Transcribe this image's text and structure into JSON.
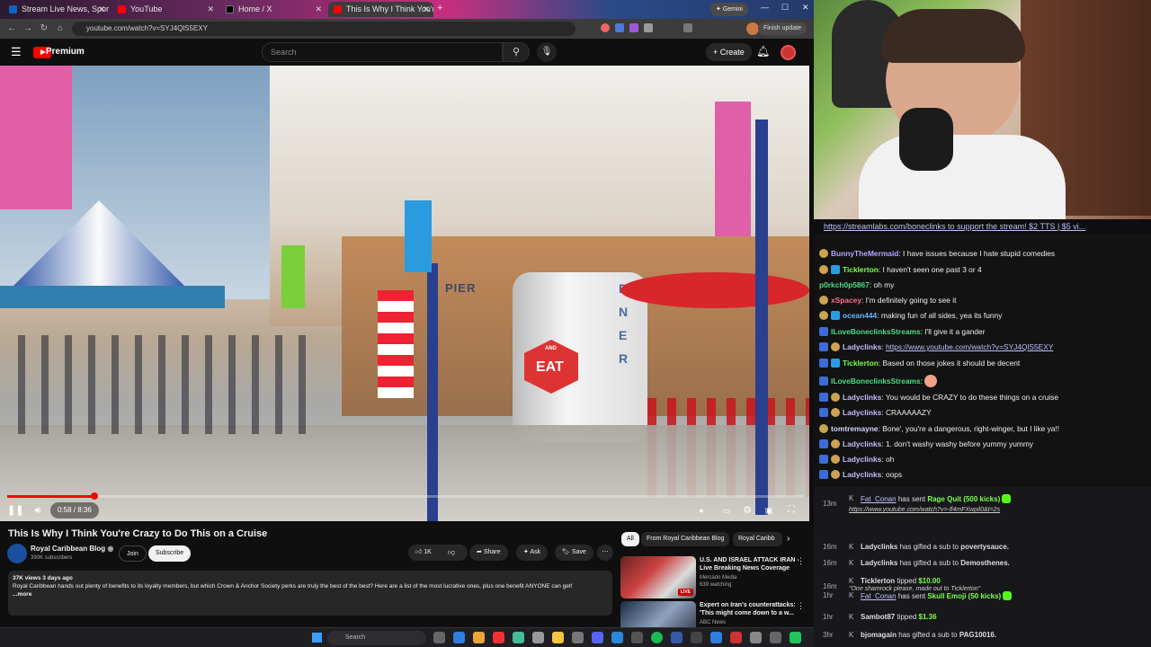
{
  "browser": {
    "tabs": [
      {
        "label": "Stream Live News, Sports...",
        "fav": "#0a66c2"
      },
      {
        "label": "YouTube",
        "fav": "#ff0000"
      },
      {
        "label": "Home / X",
        "fav": "#000000"
      },
      {
        "label": "This Is Why I Think You're C...",
        "fav": "#ff0000"
      }
    ],
    "gemini_label": "Gemini",
    "url": "youtube.com/watch?v=SYJ4QlS5EXY",
    "finish_update": "Finish update"
  },
  "youtube": {
    "logo_text": "Premium",
    "search_placeholder": "Search",
    "create_label": "Create",
    "video": {
      "time": "0:58 / 8:36",
      "progress": 0.11,
      "signs": {
        "eat": "EAT",
        "and": "AND",
        "pier": "PIER",
        "diner": "DINER"
      }
    },
    "title": "This Is Why I Think You're Crazy to Do This on a Cruise",
    "channel": {
      "name": "Royal Caribbean Blog",
      "subs": "390K subscribers"
    },
    "join_label": "Join",
    "subscribe_label": "Subscribe",
    "like_count": "1K",
    "share_label": "Share",
    "ask_label": "Ask",
    "save_label": "Save",
    "description": {
      "meta": "37K views  3 days ago",
      "text": "Royal Caribbean hands out plenty of benefits to its loyalty members, but which Crown & Anchor Society perks are truly the best of the best? Here are a list of the most lucrative ones, plus one benefit ANYONE can get!",
      "more": "...more"
    },
    "chips": [
      "All",
      "From Royal Caribbean Blog",
      "Royal Caribb"
    ],
    "related": [
      {
        "title": "U.S. AND ISRAEL ATTACK IRAN - Live Breaking News Coverage",
        "channel": "Mercado Media",
        "meta": "639 watching",
        "live": "LIVE"
      },
      {
        "title": "Expert on Iran's counterattacks: 'This might come down to a w...",
        "channel": "ABC News",
        "meta": ""
      }
    ]
  },
  "taskbar": {
    "search_label": "Search"
  },
  "stream": {
    "donation_banner": "https://streamlabs.com/boneclinks to support the stream! $2 TTS | $5 vi...",
    "chat": [
      {
        "user": "BunnyTheMermaid",
        "color": "#b5a5ff",
        "text": "I have issues because I hate stupid comedies"
      },
      {
        "user": "Ticklerton",
        "color": "#7dff4a",
        "text": "I haven't seen one past 3 or 4"
      },
      {
        "user": "p0rkch0p5867",
        "color": "#4ade80",
        "text": "oh my"
      },
      {
        "user": "xSpacey",
        "color": "#ff6a8f",
        "text": "I'm definitely going to see it"
      },
      {
        "user": "ocean444",
        "color": "#6bb6ff",
        "text": "making fun of all sides, yea its funny"
      },
      {
        "user": "ILoveBoneclinksStreams",
        "color": "#4ade80",
        "text": "I'll give it a gander"
      },
      {
        "user": "Ladyclinks",
        "color": "#c9b8ff",
        "text": "https://www.youtube.com/watch?v=SYJ4QlS5EXY"
      },
      {
        "user": "Ticklerton",
        "color": "#7dff4a",
        "text": "Based on those jokes it should be decent"
      },
      {
        "user": "ILoveBoneclinksStreams",
        "color": "#4ade80",
        "text": ""
      },
      {
        "user": "Ladyclinks",
        "color": "#c9b8ff",
        "text": "You would be CRAZY to do these things on a cruise"
      },
      {
        "user": "Ladyclinks",
        "color": "#c9b8ff",
        "text": "CRAAAAAZY"
      },
      {
        "user": "tomtremayne",
        "color": "#d2d2ff",
        "text": "Bone', you're a dangerous, right-winger, but I like ya!!"
      },
      {
        "user": "Ladyclinks",
        "color": "#c9b8ff",
        "text": "1. don't washy washy before yummy yummy"
      },
      {
        "user": "Ladyclinks",
        "color": "#c9b8ff",
        "text": "oh"
      },
      {
        "user": "Ladyclinks",
        "color": "#c9b8ff",
        "text": "oops"
      }
    ],
    "events": [
      {
        "time": "13m",
        "user": "Fat_Conan",
        "action": "has sent",
        "item": "Rage Quit (500 kicks)",
        "sub": "https://www.youtube.com/watch?v=-lf4mFXwpil0&t=2s"
      },
      {
        "time": "16m",
        "user": "Ladyclinks",
        "action": "has gifted a sub to",
        "item": "povertysauce."
      },
      {
        "time": "16m",
        "user": "Ladyclinks",
        "action": "has gifted a sub to",
        "item": "Demosthenes."
      },
      {
        "time": "16m",
        "user": "Ticklerton",
        "action": "tipped",
        "item": "$10.00",
        "sub": "\"One shamrock please, made out to Ticklerton\""
      },
      {
        "time": "1hr",
        "user": "Fat_Conan",
        "action": "has sent",
        "item": "Skull Emoji (50 kicks)"
      },
      {
        "time": "1hr",
        "user": "Sambot87",
        "action": "tipped",
        "item": "$1.36"
      },
      {
        "time": "3hr",
        "user": "bjomagain",
        "action": "has gifted a sub to",
        "item": "PAG10016."
      }
    ]
  }
}
